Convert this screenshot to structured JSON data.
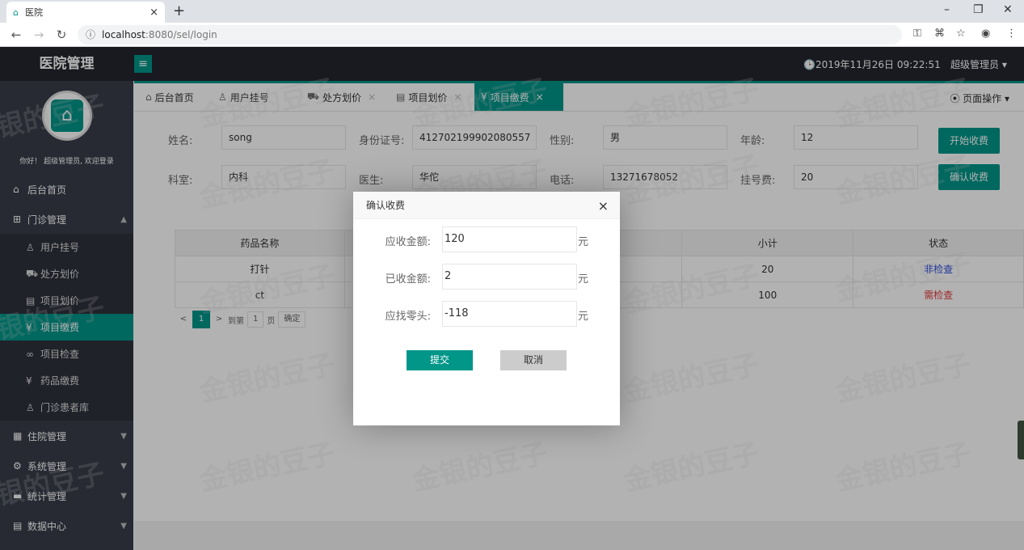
{
  "browser": {
    "tab_title": "医院",
    "tab_favicon": "hospital-icon",
    "tab_close": "×",
    "new_tab": "+",
    "url_host": "localhost",
    "url_path": ":8080/sel/login",
    "controls": {
      "minimize": "–",
      "restore": "❐",
      "close": "✕"
    }
  },
  "app": {
    "title": "医院管理",
    "datetime": "🕒2019年11月26日 09:22:51",
    "user_menu": "超级管理员 ▾",
    "greeting": "你好！ 超级管理员, 欢迎登录"
  },
  "sidebar": {
    "home": "后台首页",
    "outpatient": "门诊管理",
    "outpatient_items": [
      "用户挂号",
      "处方划价",
      "项目划价",
      "项目缴费",
      "项目检查",
      "药品缴费",
      "门诊患者库"
    ],
    "active_item": "项目缴费",
    "inpatient": "住院管理",
    "system": "系统管理",
    "stats": "统计管理",
    "data_center": "数据中心"
  },
  "page_tabs": {
    "tabs": [
      "后台首页",
      "用户挂号",
      "处方划价",
      "项目划价",
      "项目缴费"
    ],
    "active": "项目缴费",
    "page_ops": "⦿ 页面操作 ▾"
  },
  "form": {
    "name_label": "姓名:",
    "name_value": "song",
    "id_label": "身份证号:",
    "id_value": "412702199902080557",
    "gender_label": "性别:",
    "gender_value": "男",
    "age_label": "年龄:",
    "age_value": "12",
    "dept_label": "科室:",
    "dept_value": "内科",
    "doctor_label": "医生:",
    "doctor_value": "华佗",
    "phone_label": "电话:",
    "phone_value": "13271678052",
    "fee_label": "挂号费:",
    "fee_value": "20",
    "start_btn": "开始收费",
    "confirm_btn": "确认收费"
  },
  "table": {
    "headers": [
      "药品名称",
      "",
      "",
      "小计",
      "状态"
    ],
    "rows": [
      {
        "name": "打针",
        "subtotal": "20",
        "status": "非检查"
      },
      {
        "name": "ct",
        "subtotal": "100",
        "status": "需检查"
      }
    ]
  },
  "pager": {
    "prev": "<",
    "page": "1",
    "next": ">",
    "goto": "到第",
    "input": "1",
    "unit": "页",
    "confirm": "确定"
  },
  "dialog": {
    "title": "确认收费",
    "close": "×",
    "due_label": "应收金额:",
    "due_value": "120",
    "paid_label": "已收金额:",
    "paid_value": "2",
    "change_label": "应找零头:",
    "change_value": "-118",
    "unit": "元",
    "submit": "提交",
    "cancel": "取消"
  },
  "watermark": "金银的豆子",
  "colors": {
    "accent": "#009688",
    "header": "#23262e",
    "sidebar": "#393d49"
  }
}
